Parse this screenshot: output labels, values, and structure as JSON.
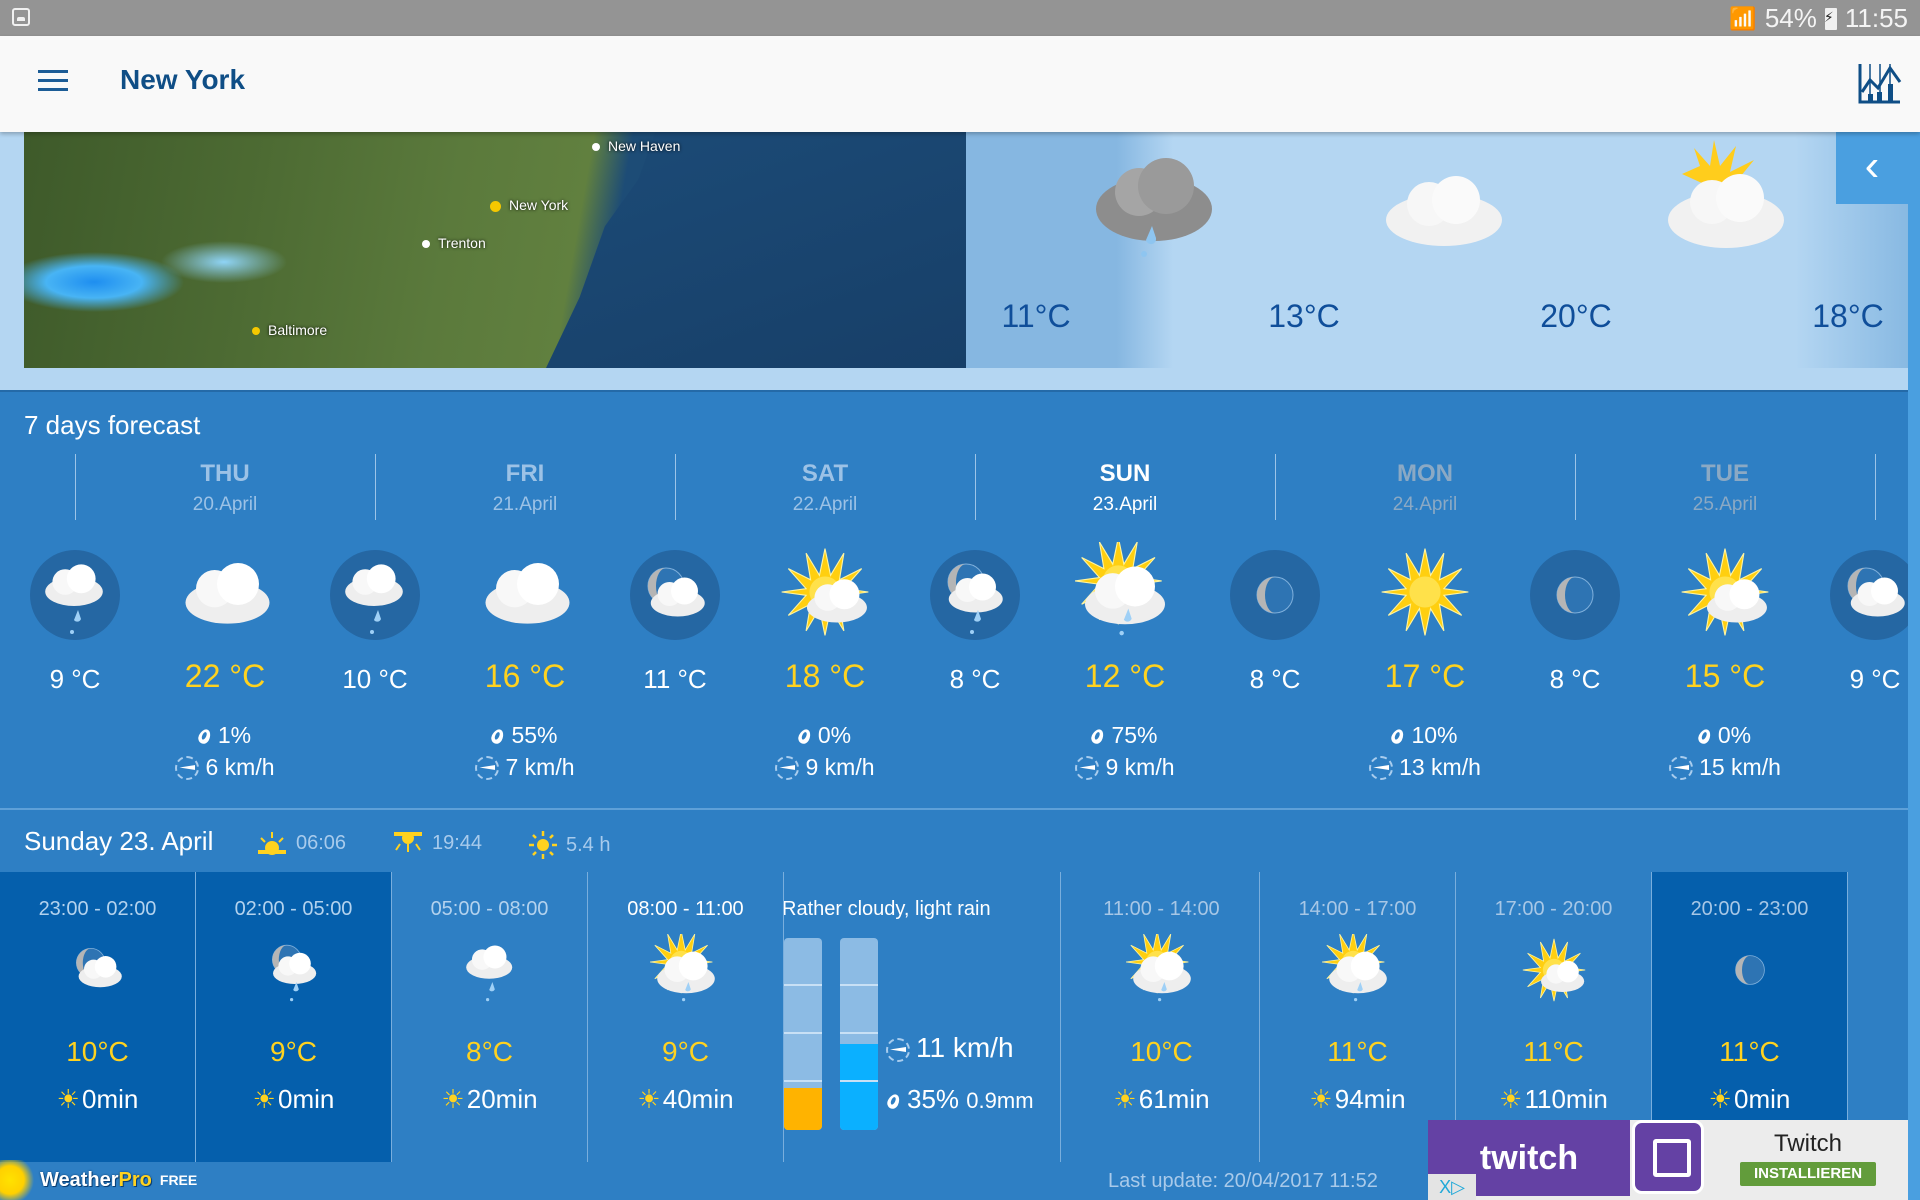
{
  "status_bar": {
    "battery": "54%",
    "time": "11:55",
    "icons": [
      "gallery-icon",
      "wifi-icon",
      "battery-charging-icon"
    ]
  },
  "app_bar": {
    "title": "New York",
    "menu_icon": "hamburger-menu-icon",
    "chart_icon": "chart-icon"
  },
  "map": {
    "cities": [
      {
        "name": "New Haven",
        "marker": "white"
      },
      {
        "name": "New York",
        "marker": "yellow"
      },
      {
        "name": "Trenton",
        "marker": "white"
      },
      {
        "name": "Baltimore",
        "marker": "yellow"
      }
    ]
  },
  "hourly_strip": {
    "collapse_icon": "chevron-left-icon",
    "items": [
      {
        "temp": "11°C",
        "icon": "rain-cloud-dark"
      },
      {
        "temp": "13°C",
        "icon": "cloud"
      },
      {
        "temp": "20°C",
        "icon": "sun-cloud"
      },
      {
        "temp": "18°C",
        "icon": ""
      }
    ]
  },
  "seven_days": {
    "title": "7 days forecast",
    "days": [
      {
        "day": "THU",
        "date": "20.April",
        "state": "past",
        "night_temp": "9 °C",
        "night_icon": "cloud-rain",
        "day_temp": "22 °C",
        "day_icon": "cloud",
        "rain": "1%",
        "wind": "6 km/h"
      },
      {
        "day": "FRI",
        "date": "21.April",
        "state": "past",
        "night_temp": "10 °C",
        "night_icon": "cloud-rain",
        "day_temp": "16 °C",
        "day_icon": "cloud",
        "rain": "55%",
        "wind": "7 km/h"
      },
      {
        "day": "SAT",
        "date": "22.April",
        "state": "past",
        "night_temp": "11 °C",
        "night_icon": "moon-cloud",
        "day_temp": "18 °C",
        "day_icon": "sun-cloud",
        "rain": "0%",
        "wind": "9 km/h"
      },
      {
        "day": "SUN",
        "date": "23.April",
        "state": "today",
        "night_temp": "8 °C",
        "night_icon": "moon-cloud-rain",
        "day_temp": "12 °C",
        "day_icon": "sun-cloud-rain",
        "rain": "75%",
        "wind": "9 km/h"
      },
      {
        "day": "MON",
        "date": "24.April",
        "state": "future",
        "night_temp": "8 °C",
        "night_icon": "moon",
        "day_temp": "17 °C",
        "day_icon": "sun",
        "rain": "10%",
        "wind": "13 km/h"
      },
      {
        "day": "TUE",
        "date": "25.April",
        "state": "future",
        "night_temp": "8 °C",
        "night_icon": "moon",
        "day_temp": "15 °C",
        "day_icon": "sun-cloud",
        "rain": "0%",
        "wind": "15 km/h"
      }
    ],
    "trailing_night": {
      "temp": "9 °C",
      "icon": "moon-cloud"
    }
  },
  "day_detail": {
    "title": "Sunday 23. April",
    "sunrise": "06:06",
    "sunset": "19:44",
    "sunshine": "5.4 h",
    "slots_before": [
      {
        "time": "23:00 - 02:00",
        "temp": "10°C",
        "sun": "0",
        "night": true,
        "icon": "moon-cloud",
        "state": "past"
      },
      {
        "time": "02:00 - 05:00",
        "temp": "9°C",
        "sun": "0",
        "night": true,
        "icon": "moon-cloud-rain",
        "state": "past"
      },
      {
        "time": "05:00 - 08:00",
        "temp": "8°C",
        "sun": "20",
        "night": false,
        "icon": "cloud-rain",
        "state": "past"
      },
      {
        "time": "08:00 - 11:00",
        "temp": "9°C",
        "sun": "40",
        "night": false,
        "icon": "sun-cloud-rain",
        "state": "current"
      }
    ],
    "selected": {
      "condition": "Rather cloudy, light rain",
      "wind": "11 km/h",
      "rain_chance": "35%",
      "rain_amount": "0.9mm",
      "sun_bar_fraction": 0.22,
      "rain_bar_fraction": 0.45
    },
    "slots_after": [
      {
        "time": "11:00 - 14:00",
        "temp": "10°C",
        "sun": "61",
        "night": false,
        "icon": "sun-cloud-rain",
        "state": "future"
      },
      {
        "time": "14:00 - 17:00",
        "temp": "11°C",
        "sun": "94",
        "night": false,
        "icon": "sun-cloud-rain",
        "state": "future"
      },
      {
        "time": "17:00 - 20:00",
        "temp": "11°C",
        "sun": "110",
        "night": false,
        "icon": "sun-cloud",
        "state": "future"
      },
      {
        "time": "20:00 - 23:00",
        "temp": "11°C",
        "sun": "0",
        "night": true,
        "icon": "moon",
        "state": "future"
      }
    ],
    "min_unit": "min"
  },
  "footer": {
    "logo_brand": "Weather",
    "logo_pro": "Pro",
    "logo_free": "FREE",
    "last_update": "Last update: 20/04/2017 11:52"
  },
  "ad": {
    "brand_text": "twitch",
    "app_name": "Twitch",
    "install_label": "INSTALLIEREN",
    "choice_label": "X▷"
  },
  "colors": {
    "primary": "#2e7fc4",
    "night": "#055fac",
    "title": "#0f4e86",
    "temp_day": "#ffd21f",
    "sun_bar": "#ffb300",
    "rain_bar": "#0bb0ff"
  }
}
